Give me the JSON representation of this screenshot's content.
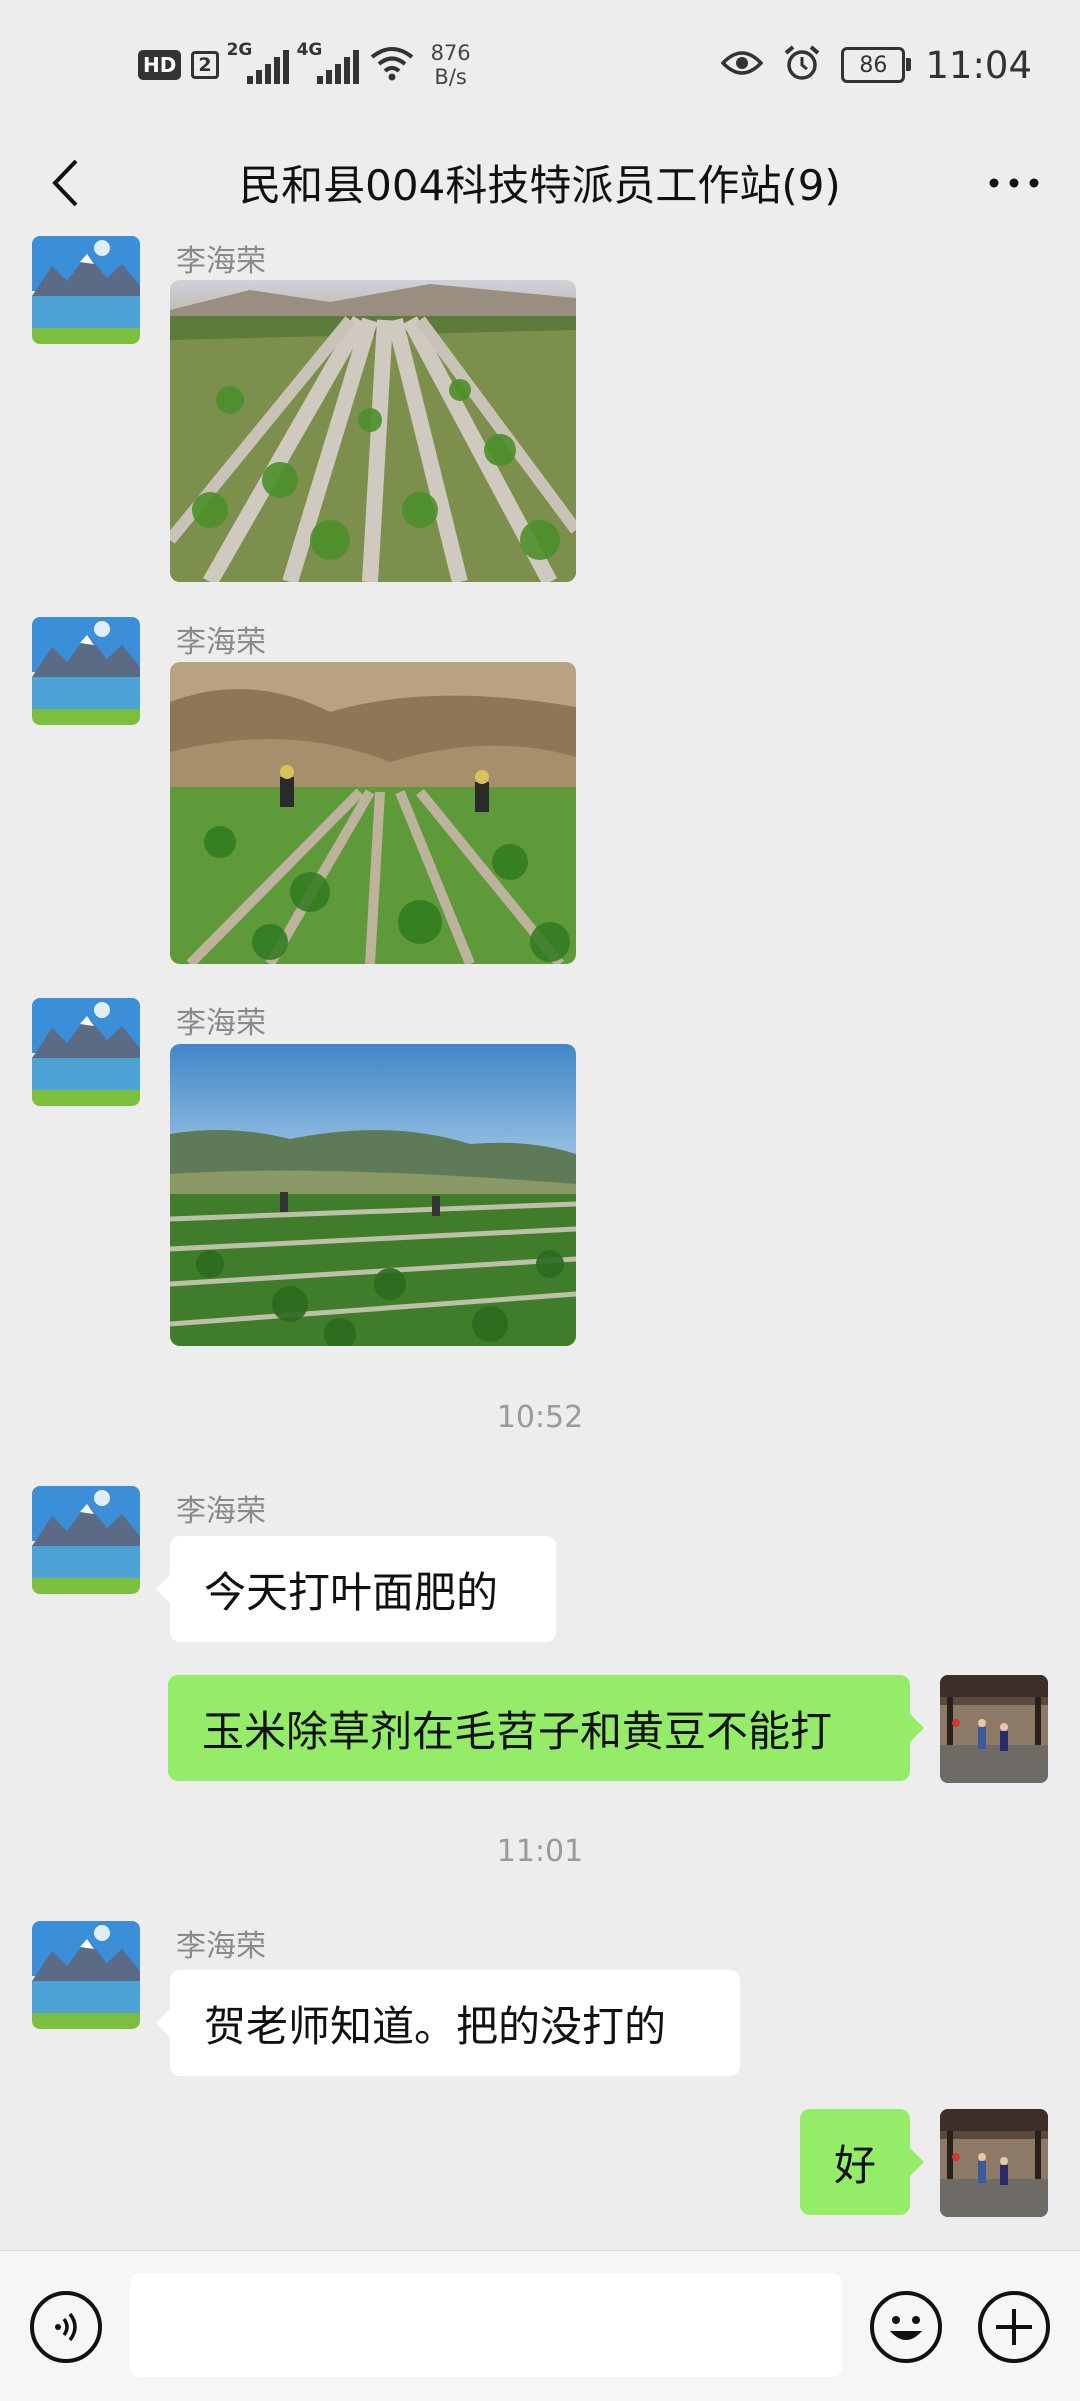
{
  "status_bar": {
    "hd_label": "HD",
    "sim_label": "2",
    "net1": "2G",
    "net2": "4G",
    "speed_value": "876",
    "speed_unit": "B/s",
    "battery": "86",
    "time": "11:04"
  },
  "header": {
    "title": "民和县004科技特派员工作站(9)"
  },
  "messages": [
    {
      "type": "image",
      "sender": "李海荣",
      "scene": "young corn field rows with plastic mulch, hills in background"
    },
    {
      "type": "image",
      "sender": "李海荣",
      "scene": "two workers spraying corn field below eroded hillside"
    },
    {
      "type": "image",
      "sender": "李海荣",
      "scene": "blue sky, green mountains, potato field with two workers"
    },
    {
      "type": "time",
      "text": "10:52"
    },
    {
      "type": "text_in",
      "sender": "李海荣",
      "text": "今天打叶面肥的"
    },
    {
      "type": "text_out",
      "text": "玉米除草剂在毛苕子和黄豆不能打"
    },
    {
      "type": "time",
      "text": "11:01"
    },
    {
      "type": "text_in",
      "sender": "李海荣",
      "text": "贺老师知道。把的没打的"
    },
    {
      "type": "text_out",
      "text": "好"
    }
  ],
  "colors": {
    "background": "#ededed",
    "outgoing_bubble": "#95ec69",
    "incoming_bubble": "#ffffff",
    "input_bar": "#f6f6f6"
  },
  "icons": [
    "back-icon",
    "more-icon",
    "eye-icon",
    "alarm-icon",
    "wifi-icon",
    "voice-icon",
    "emoji-icon",
    "plus-icon"
  ]
}
